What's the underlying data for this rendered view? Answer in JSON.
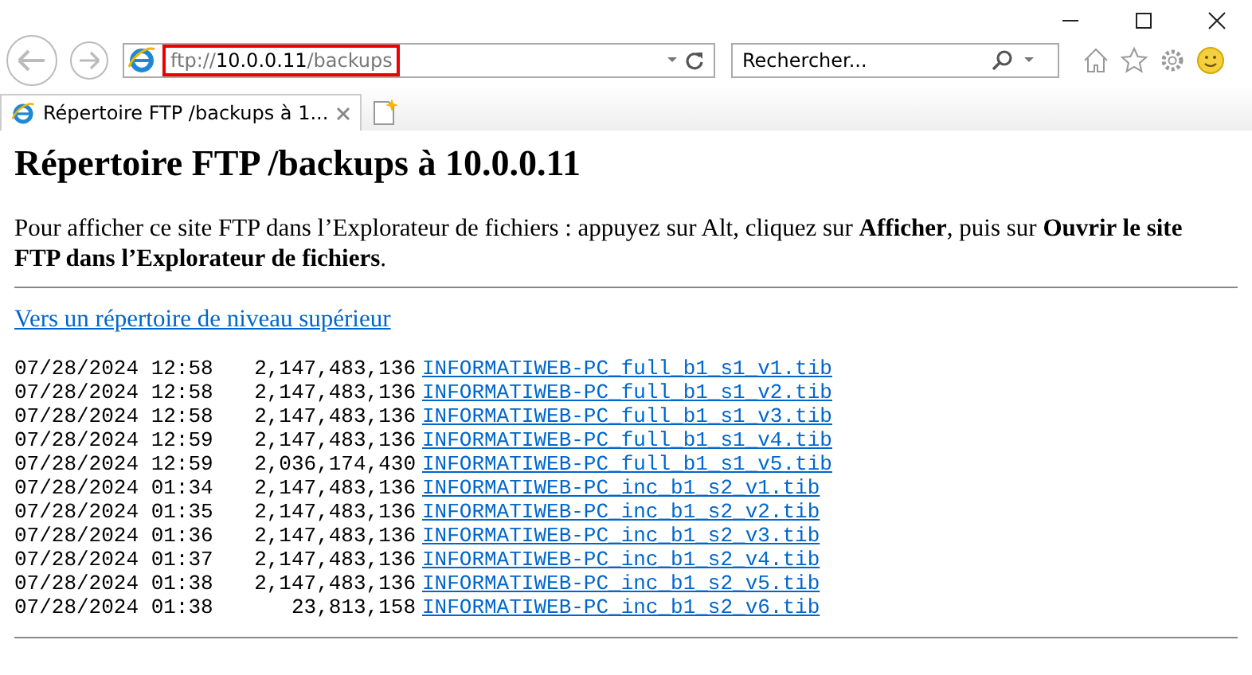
{
  "address_bar": {
    "url_prefix": "ftp://",
    "url_host": "10.0.0.11",
    "url_path": "/backups",
    "highlighted": true
  },
  "search": {
    "placeholder": "Rechercher..."
  },
  "tabs": [
    {
      "title": "Répertoire FTP /backups à 1...",
      "selected": true
    }
  ],
  "page": {
    "heading": "Répertoire FTP /backups à 10.0.0.11",
    "instructions": "Pour afficher ce site FTP dans l’Explorateur de fichiers : appuyez sur Alt, cliquez sur **Afficher**, puis sur **Ouvrir le site FTP dans l’Explorateur de fichiers**.",
    "parent_link": "Vers un répertoire de niveau supérieur",
    "files": [
      {
        "date": "07/28/2024 12:58",
        "size": "2,147,483,136",
        "name": "INFORMATIWEB-PC_full_b1_s1_v1.tib"
      },
      {
        "date": "07/28/2024 12:58",
        "size": "2,147,483,136",
        "name": "INFORMATIWEB-PC_full_b1_s1_v2.tib"
      },
      {
        "date": "07/28/2024 12:58",
        "size": "2,147,483,136",
        "name": "INFORMATIWEB-PC_full_b1_s1_v3.tib"
      },
      {
        "date": "07/28/2024 12:59",
        "size": "2,147,483,136",
        "name": "INFORMATIWEB-PC_full_b1_s1_v4.tib"
      },
      {
        "date": "07/28/2024 12:59",
        "size": "2,036,174,430",
        "name": "INFORMATIWEB-PC_full_b1_s1_v5.tib"
      },
      {
        "date": "07/28/2024 01:34",
        "size": "2,147,483,136",
        "name": "INFORMATIWEB-PC_inc_b1_s2_v1.tib"
      },
      {
        "date": "07/28/2024 01:35",
        "size": "2,147,483,136",
        "name": "INFORMATIWEB-PC_inc_b1_s2_v2.tib"
      },
      {
        "date": "07/28/2024 01:36",
        "size": "2,147,483,136",
        "name": "INFORMATIWEB-PC_inc_b1_s2_v3.tib"
      },
      {
        "date": "07/28/2024 01:37",
        "size": "2,147,483,136",
        "name": "INFORMATIWEB-PC_inc_b1_s2_v4.tib"
      },
      {
        "date": "07/28/2024 01:38",
        "size": "2,147,483,136",
        "name": "INFORMATIWEB-PC_inc_b1_s2_v5.tib"
      },
      {
        "date": "07/28/2024 01:38",
        "size": "23,813,158",
        "name": "INFORMATIWEB-PC_inc_b1_s2_v6.tib"
      }
    ]
  }
}
